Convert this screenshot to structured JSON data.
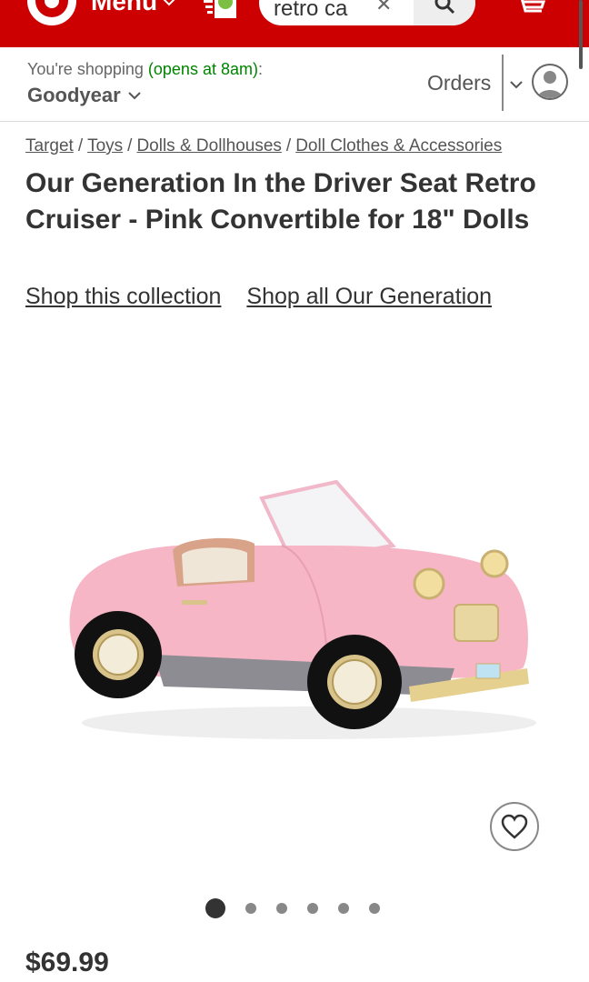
{
  "header": {
    "menu_label": "Menu",
    "search": {
      "value": "retro ca",
      "clear": "✕"
    },
    "brand_color": "#cc0000"
  },
  "store": {
    "shopping_prefix": "You're shopping",
    "open_status": "(opens at 8am)",
    "colon": ":",
    "store_name": "Goodyear",
    "orders_label": "Orders"
  },
  "breadcrumb": [
    {
      "label": "Target"
    },
    {
      "label": "Toys"
    },
    {
      "label": "Dolls & Dollhouses"
    },
    {
      "label": "Doll Clothes & Accessories"
    }
  ],
  "breadcrumb_sep": "/",
  "product": {
    "title": "Our Generation In the Driver Seat Retro Cruiser - Pink Convertible for 18\" Dolls",
    "shop_collection": "Shop this collection",
    "shop_brand": "Shop all Our Generation",
    "price": "$69.99",
    "carousel": {
      "total": 6,
      "active": 1
    }
  },
  "icons": [
    "target-logo-icon",
    "chevron-down-icon",
    "promo-icon",
    "close-icon",
    "search-icon",
    "cart-icon",
    "user-icon",
    "heart-icon"
  ]
}
